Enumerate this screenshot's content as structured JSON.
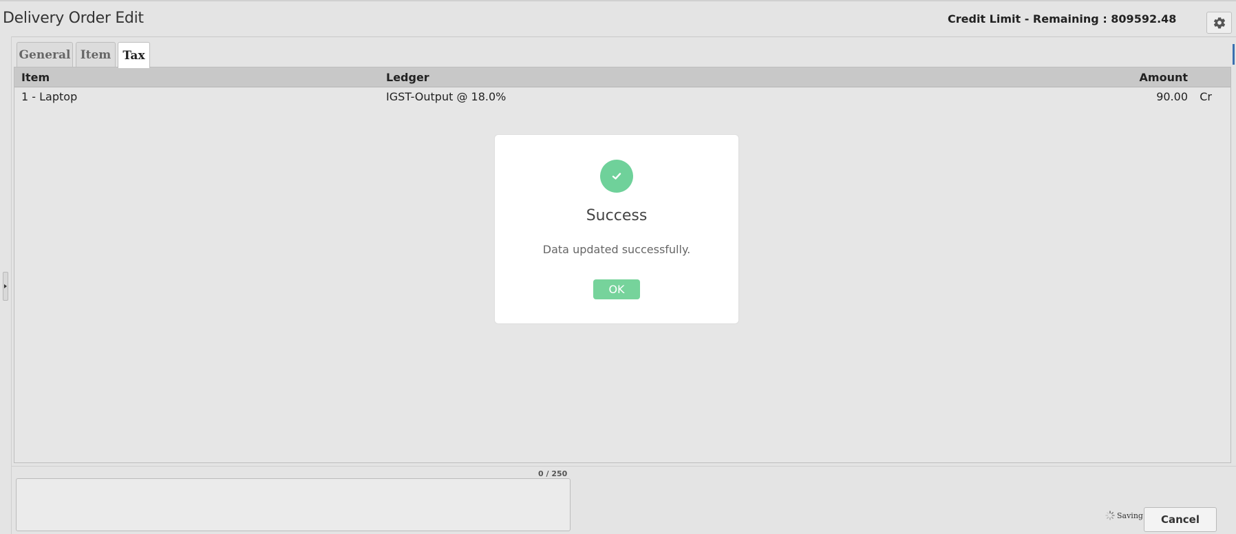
{
  "header": {
    "title": "Delivery Order Edit",
    "credit_text": "Credit Limit - Remaining : 809592.48",
    "settings_icon": "gear-icon"
  },
  "tabs": [
    {
      "label": "General",
      "active": false
    },
    {
      "label": "Item",
      "active": false
    },
    {
      "label": "Tax",
      "active": true
    }
  ],
  "tax_table": {
    "columns": [
      "Item",
      "Ledger",
      "Amount"
    ],
    "rows": [
      {
        "item": "1 - Laptop",
        "ledger": "IGST-Output @ 18.0%",
        "amount": "90.00",
        "dr_cr": "Cr"
      }
    ]
  },
  "remarks": {
    "char_count": "0 / 250",
    "value": ""
  },
  "footer": {
    "saving_label": "Saving",
    "cancel_label": "Cancel"
  },
  "dialog": {
    "title": "Success",
    "message": "Data updated successfully.",
    "ok_label": "OK",
    "icon": "check-icon"
  },
  "colors": {
    "success_green": "#6fd19a",
    "ok_button": "#76d39b",
    "table_header": "#c8c8c8"
  }
}
